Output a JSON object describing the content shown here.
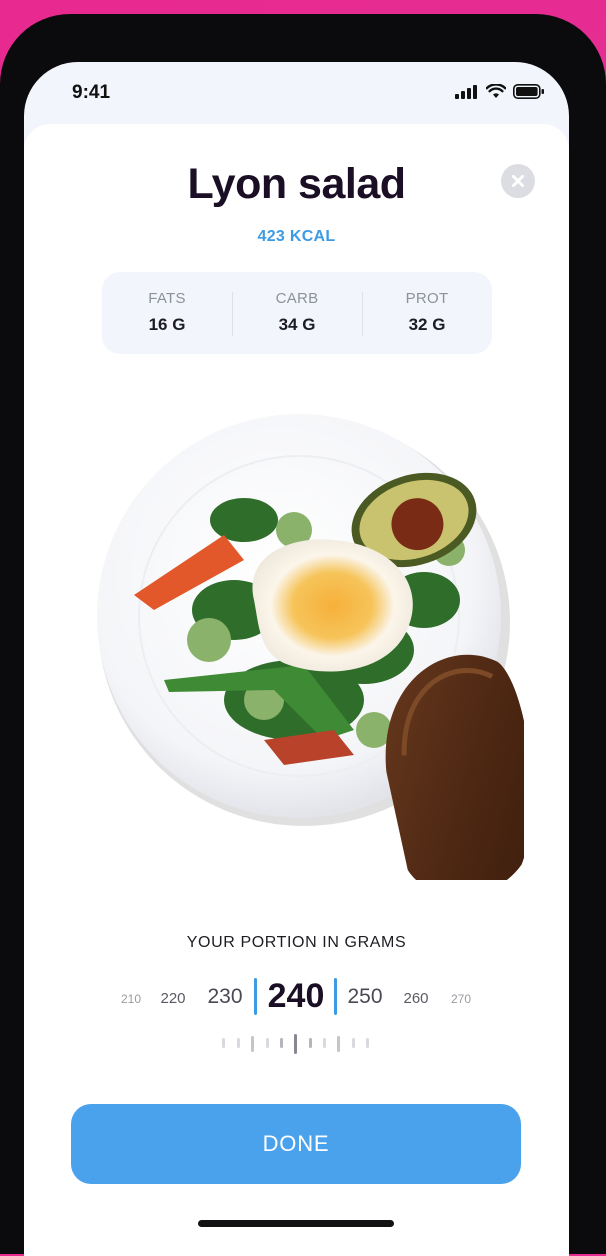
{
  "status": {
    "time": "9:41"
  },
  "dish": {
    "title": "Lyon salad",
    "calories": "423 KCAL"
  },
  "macros": [
    {
      "label": "FATS",
      "value": "16 G"
    },
    {
      "label": "CARB",
      "value": "34 G"
    },
    {
      "label": "PROT",
      "value": "32 G"
    }
  ],
  "portion": {
    "label": "YOUR PORTION IN GRAMS",
    "options": [
      "210",
      "220",
      "230",
      "240",
      "250",
      "260",
      "270"
    ],
    "selected": "240"
  },
  "actions": {
    "done_label": "DONE"
  },
  "icons": {
    "close": "close-icon",
    "signal": "cellular-signal-icon",
    "wifi": "wifi-icon",
    "battery": "battery-icon"
  },
  "colors": {
    "accent": "#3d9be3",
    "button": "#4aa2ec",
    "title": "#1a0f24"
  }
}
